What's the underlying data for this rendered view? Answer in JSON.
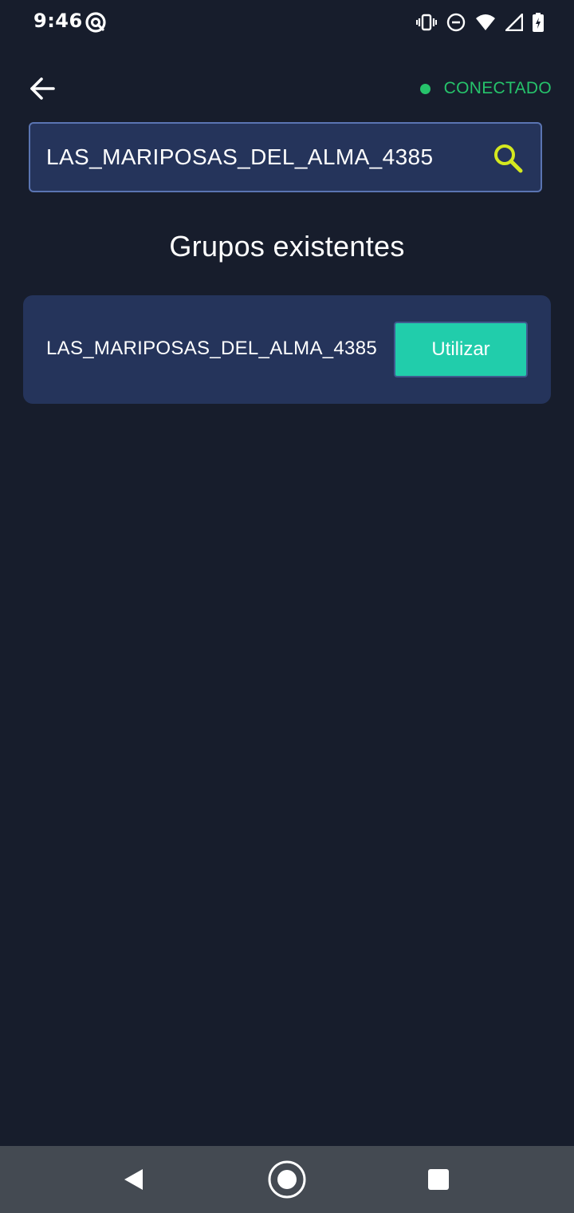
{
  "status_bar": {
    "time": "9:46",
    "icons": [
      "app-notification-icon",
      "vibrate-icon",
      "do-not-disturb-icon",
      "wifi-icon",
      "signal-icon",
      "battery-charging-icon"
    ]
  },
  "header": {
    "back_icon": "arrow-left-icon",
    "connection_status": "CONECTADO",
    "connection_color": "#26c36b"
  },
  "search": {
    "value": "LAS_MARIPOSAS_DEL_ALMA_4385",
    "icon": "search-icon",
    "icon_color": "#d4e81f"
  },
  "section_title": "Grupos existentes",
  "groups": [
    {
      "name": "LAS_MARIPOSAS_DEL_ALMA_4385",
      "action_label": "Utilizar"
    }
  ],
  "colors": {
    "background": "#171d2c",
    "card": "#25345b",
    "accent_button": "#21cdab",
    "nav_bar": "#444a52"
  },
  "nav": {
    "items": [
      "back-triangle-icon",
      "home-circle-icon",
      "recents-square-icon"
    ]
  }
}
